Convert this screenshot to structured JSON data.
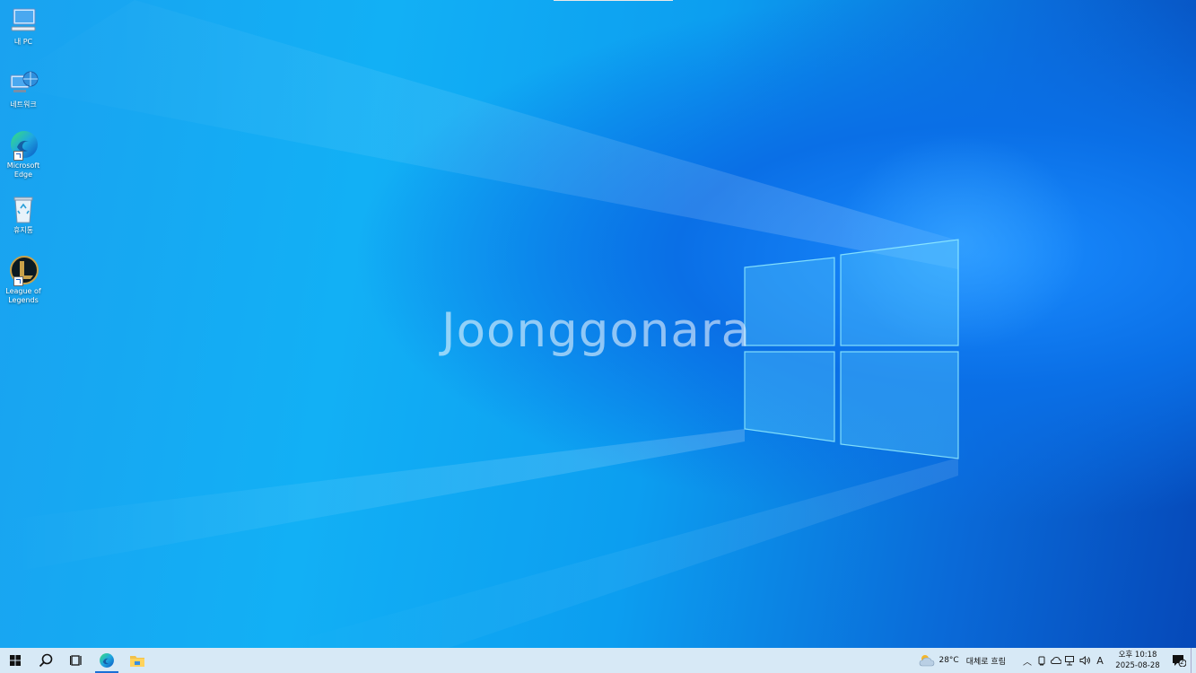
{
  "desktop": {
    "icons": [
      {
        "label": "내 PC",
        "icon": "computer-icon"
      },
      {
        "label": "네트워크",
        "icon": "network-icon"
      },
      {
        "label_line1": "Microsoft",
        "label_line2": "Edge",
        "icon": "edge-icon"
      },
      {
        "label": "휴지통",
        "icon": "recycle-bin-icon"
      },
      {
        "label_line1": "League of",
        "label_line2": "Legends",
        "icon": "league-of-legends-icon"
      }
    ],
    "watermark": "Joonggonara"
  },
  "taskbar": {
    "weather": {
      "temp": "28°C",
      "condition": "대체로 흐림"
    },
    "input_indicator": "A",
    "clock": {
      "time": "오후 10:18",
      "date": "2025-08-28"
    },
    "notification_count": "2"
  },
  "colors": {
    "taskbar": "#d7e9f6",
    "accent": "#1a6fd6"
  }
}
